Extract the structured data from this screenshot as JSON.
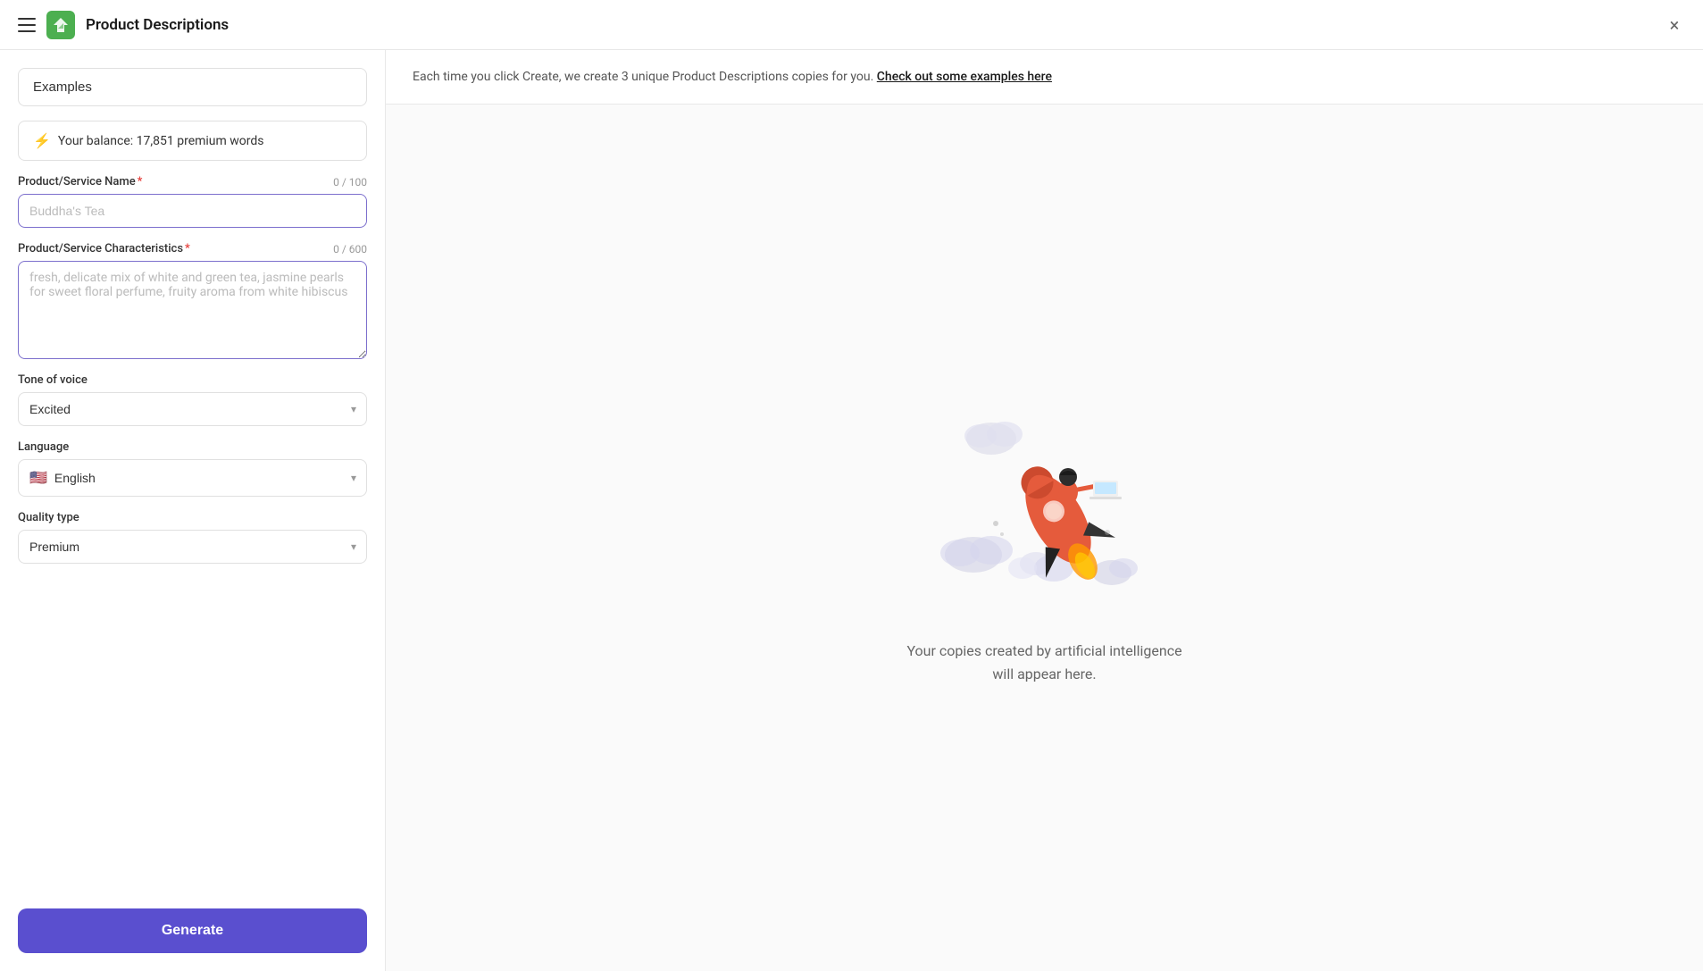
{
  "topbar": {
    "title": "Product Descriptions",
    "close_label": "×"
  },
  "sidebar": {
    "examples_label": "Examples",
    "balance_label": "Your balance: 17,851 premium words",
    "product_name_label": "Product/Service Name",
    "product_name_counter": "0 / 100",
    "product_name_placeholder": "Buddha's Tea",
    "characteristics_label": "Product/Service Characteristics",
    "characteristics_counter": "0 / 600",
    "characteristics_placeholder": "fresh, delicate mix of white and green tea, jasmine pearls for sweet floral perfume, fruity aroma from white hibiscus",
    "tone_label": "Tone of voice",
    "tone_value": "Excited",
    "language_label": "Language",
    "language_value": "English",
    "quality_label": "Quality type",
    "quality_value": "Premium",
    "generate_label": "Generate"
  },
  "infobar": {
    "text": "Each time you click Create, we create 3 unique Product Descriptions copies for you.",
    "link_text": "Check out some examples here"
  },
  "empty_state": {
    "line1": "Your copies created by artificial intelligence",
    "line2": "will appear here."
  }
}
